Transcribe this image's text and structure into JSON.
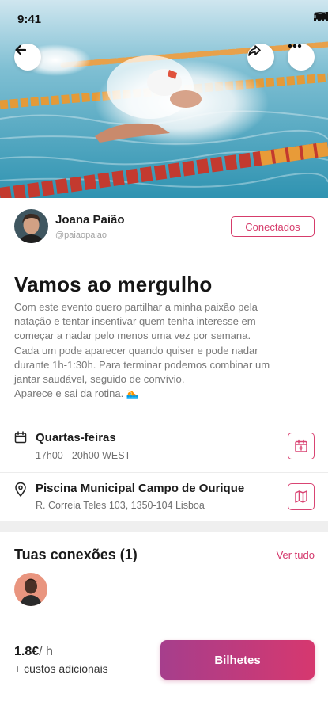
{
  "status_bar": {
    "time": "9:41"
  },
  "host": {
    "name": "Joana Paião",
    "handle": "@paiaopaiao",
    "connect_label": "Conectados"
  },
  "event": {
    "title": "Vamos ao mergulho",
    "description_lines": [
      "Com este evento quero partilhar a minha paixão pela",
      "natação e tentar insentivar quem tenha interesse em",
      "começar a nadar pelo menos uma vez por semana.",
      "Cada um pode aparecer quando quiser e pode nadar",
      "durante 1h-1:30h. Para terminar podemos combinar um",
      "jantar saudável, seguido de convívio.",
      "Aparece e sai da rotina. 🏊"
    ],
    "schedule": {
      "title": "Quartas-feiras",
      "time": "17h00 - 20h00  WEST"
    },
    "location": {
      "title": "Piscina Municipal Campo de Ourique",
      "address": "R. Correia Teles 103, 1350-104 Lisboa"
    }
  },
  "connections": {
    "title": "Tuas conexões (1)",
    "see_all": "Ver tudo"
  },
  "footer": {
    "price": "1.8€",
    "price_unit": "/ h",
    "extra": "+ custos adicionais",
    "cta": "Bilhetes"
  },
  "icons": {
    "back": "arrow-left-icon",
    "share": "share-icon",
    "more": "more-horizontal-icon",
    "calendar": "calendar-icon",
    "location": "map-pin-icon",
    "add_calendar": "calendar-plus-icon",
    "map": "map-icon"
  },
  "colors": {
    "accent": "#d63c6b",
    "cta_gradient_start": "#a63e8c",
    "cta_gradient_end": "#d6386f"
  }
}
